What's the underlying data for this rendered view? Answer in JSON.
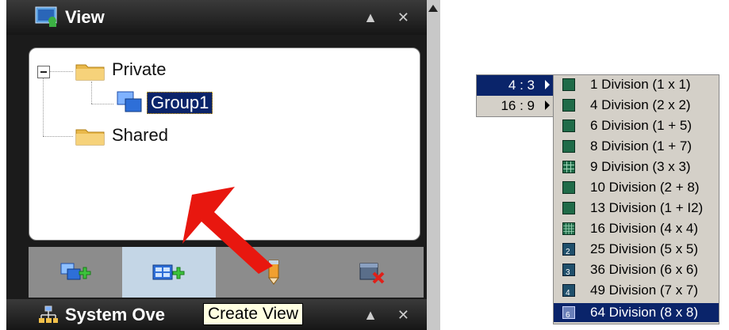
{
  "view_panel": {
    "title": "View",
    "title_buttons": "▲ ✕",
    "tree": {
      "private_label": "Private",
      "group_label": "Group1",
      "shared_label": "Shared"
    },
    "toolbar": {
      "add_group_icon": "group-add-icon",
      "create_view_icon": "view-add-icon",
      "edit_icon": "pencil-icon",
      "delete_icon": "delete-icon"
    }
  },
  "system_bar": {
    "title": "System Ove",
    "title_buttons": "▲ ✕"
  },
  "tooltip": {
    "text": "Create View"
  },
  "ratio_menu": {
    "items": [
      {
        "label": "4 : 3"
      },
      {
        "label": "16 : 9"
      }
    ]
  },
  "division_menu": {
    "items": [
      {
        "label": "1 Division (1 x 1)"
      },
      {
        "label": "4 Division (2 x 2)"
      },
      {
        "label": "6 Division (1 + 5)"
      },
      {
        "label": "8 Division (1 + 7)"
      },
      {
        "label": "9 Division (3 x 3)"
      },
      {
        "label": "10 Division (2 + 8)"
      },
      {
        "label": "13 Division (1 + I2)"
      },
      {
        "label": "16 Division (4 x 4)"
      },
      {
        "label": "25 Division (5 x 5)"
      },
      {
        "label": "36 Division (6 x 6)"
      },
      {
        "label": "49 Division (7 x 7)"
      },
      {
        "label": "64 Division (8 x 8)"
      }
    ]
  },
  "colors": {
    "selection": "#0a246a",
    "menu_bg": "#d4d0c8",
    "arrow": "#e8170f",
    "tooltip_bg": "#ffffe1"
  }
}
